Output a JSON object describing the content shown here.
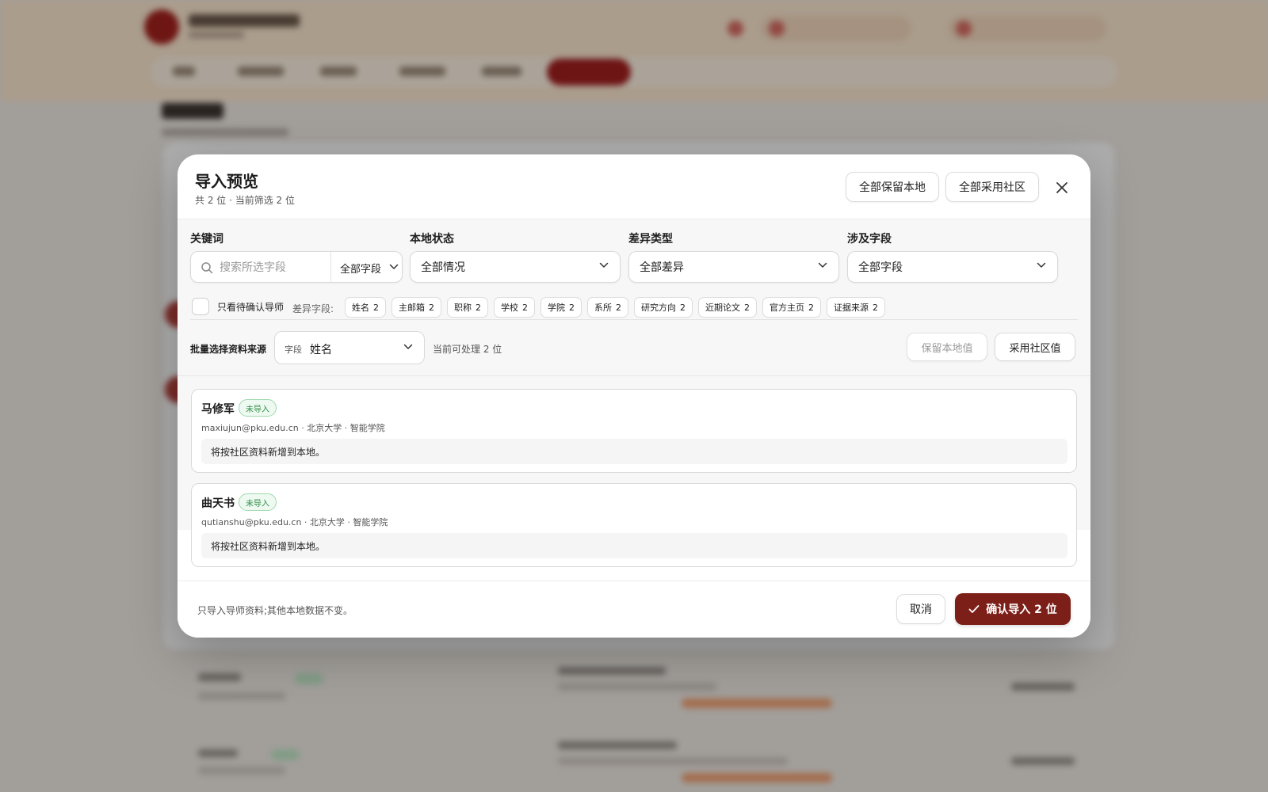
{
  "modal": {
    "title": "导入预览",
    "subtitle": "共 2 位 · 当前筛选 2 位",
    "keep_all_local": "全部保留本地",
    "adopt_all_community": "全部采用社区"
  },
  "filters": {
    "keyword_label": "关键词",
    "keyword_placeholder": "搜索所选字段",
    "keyword_scope": "全部字段",
    "local_status_label": "本地状态",
    "local_status_value": "全部情况",
    "diff_type_label": "差异类型",
    "diff_type_value": "全部差异",
    "fields_label": "涉及字段",
    "fields_value": "全部字段",
    "pending_only_label": "只看待确认导师",
    "diff_fields_label": "差异字段:",
    "diff_chips": [
      {
        "label": "姓名",
        "count": "2"
      },
      {
        "label": "主邮箱",
        "count": "2"
      },
      {
        "label": "职称",
        "count": "2"
      },
      {
        "label": "学校",
        "count": "2"
      },
      {
        "label": "学院",
        "count": "2"
      },
      {
        "label": "系所",
        "count": "2"
      },
      {
        "label": "研究方向",
        "count": "2"
      },
      {
        "label": "近期论文",
        "count": "2"
      },
      {
        "label": "官方主页",
        "count": "2"
      },
      {
        "label": "证据来源",
        "count": "2"
      }
    ]
  },
  "batch": {
    "label": "批量选择资料来源",
    "field_key": "字段",
    "field_value": "姓名",
    "count_text": "当前可处理 2 位",
    "keep_local": "保留本地值",
    "adopt_community": "采用社区值"
  },
  "rows": [
    {
      "name": "马修军",
      "badge": "未导入",
      "meta": "maxiujun@pku.edu.cn · 北京大学 · 智能学院",
      "note": "将按社区资料新增到本地。"
    },
    {
      "name": "曲天书",
      "badge": "未导入",
      "meta": "qutianshu@pku.edu.cn · 北京大学 · 智能学院",
      "note": "将按社区资料新增到本地。"
    }
  ],
  "footer": {
    "note": "只导入导师资料;其他本地数据不变。",
    "cancel": "取消",
    "confirm": "确认导入 2 位"
  },
  "colors": {
    "primary": "#7c1f18",
    "badge_green": "#2e8b46"
  },
  "icons": [
    "search-icon",
    "chevron-down-icon",
    "close-icon",
    "check-icon"
  ]
}
